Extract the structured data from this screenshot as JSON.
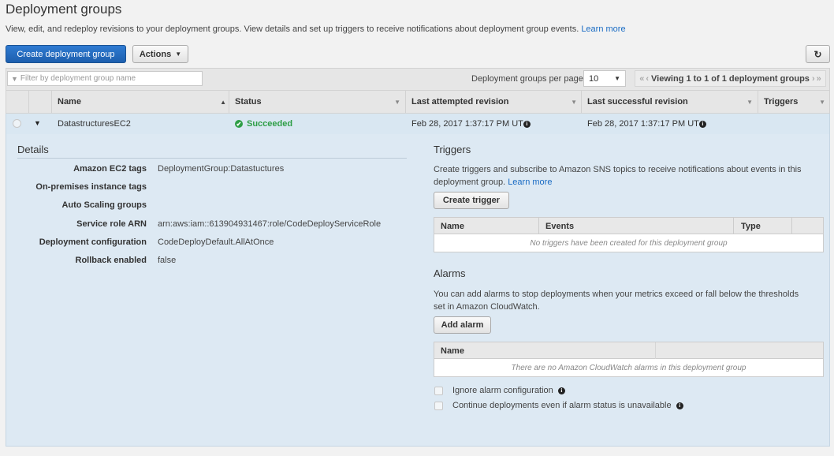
{
  "page": {
    "title": "Deployment groups",
    "subtitle": "View, edit, and redeploy revisions to your deployment groups. View details and set up triggers to receive notifications about deployment group events.",
    "learn_more": "Learn more"
  },
  "toolbar": {
    "create_label": "Create deployment group",
    "actions_label": "Actions",
    "filter_placeholder": "Filter by deployment group name",
    "per_page_label": "Deployment groups per page",
    "per_page_value": "10",
    "pagination_text": "Viewing 1 to 1 of 1 deployment groups"
  },
  "table": {
    "columns": [
      "Name",
      "Status",
      "Last attempted revision",
      "Last successful revision",
      "Triggers"
    ],
    "row": {
      "name": "DatastructuresEC2",
      "status": "Succeeded",
      "last_attempted": "Feb 28, 2017 1:37:17 PM UT",
      "last_successful": "Feb 28, 2017 1:37:17 PM UT"
    }
  },
  "details": {
    "title": "Details",
    "items": [
      {
        "label": "Amazon EC2 tags",
        "value": "DeploymentGroup:Datastuctures"
      },
      {
        "label": "On-premises instance tags",
        "value": ""
      },
      {
        "label": "Auto Scaling groups",
        "value": ""
      },
      {
        "label": "Service role ARN",
        "value": "arn:aws:iam::613904931467:role/CodeDeployServiceRole"
      },
      {
        "label": "Deployment configuration",
        "value": "CodeDeployDefault.AllAtOnce"
      },
      {
        "label": "Rollback enabled",
        "value": "false"
      }
    ]
  },
  "triggers": {
    "title": "Triggers",
    "description": "Create triggers and subscribe to Amazon SNS topics to receive notifications about events in this deployment group.",
    "learn_more": "Learn more",
    "create_label": "Create trigger",
    "columns": [
      "Name",
      "Events",
      "Type"
    ],
    "empty": "No triggers have been created for this deployment group"
  },
  "alarms": {
    "title": "Alarms",
    "description": "You can add alarms to stop deployments when your metrics exceed or fall below the thresholds set in Amazon CloudWatch.",
    "add_label": "Add alarm",
    "column": "Name",
    "empty": "There are no Amazon CloudWatch alarms in this deployment group",
    "ignore_label": "Ignore alarm configuration",
    "continue_label": "Continue deployments even if alarm status is unavailable"
  },
  "colors": {
    "primary": "#1d5fae",
    "success": "#2e9e46",
    "link": "#1a6cc4",
    "panel": "#dde9f3"
  }
}
